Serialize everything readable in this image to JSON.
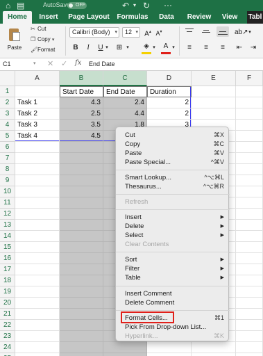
{
  "titlebar": {
    "autosave_label": "AutoSave",
    "autosave_state": "OFF",
    "icons": [
      "home-icon",
      "save-icon",
      "undo-icon",
      "undo-dropdown-icon",
      "redo-icon",
      "more-icon"
    ]
  },
  "tabs": [
    "Home",
    "Insert",
    "Page Layout",
    "Formulas",
    "Data",
    "Review",
    "View",
    "Tabl"
  ],
  "ribbon": {
    "paste_label": "Paste",
    "cut_label": "Cut",
    "copy_label": "Copy",
    "format_label": "Format",
    "font_name": "Calibri (Body)",
    "font_size": "12",
    "bold": "B",
    "italic": "I",
    "underline": "U",
    "fill_color": "#f5d000",
    "font_color": "#e0201a"
  },
  "formula_bar": {
    "name_box": "C1",
    "fx": "fx",
    "content": "End Date"
  },
  "grid": {
    "columns": [
      "A",
      "B",
      "C",
      "D",
      "E",
      "F"
    ],
    "rows": [
      "1",
      "2",
      "3",
      "4",
      "5",
      "6",
      "7",
      "8",
      "9",
      "10",
      "11",
      "12",
      "13",
      "14",
      "15",
      "16",
      "17",
      "18",
      "19",
      "20",
      "21",
      "22",
      "23",
      "24",
      "25"
    ],
    "data": [
      [
        "",
        "Start Date",
        "End Date",
        "Duration"
      ],
      [
        "Task 1",
        "4.3",
        "2.4",
        "2"
      ],
      [
        "Task 2",
        "2.5",
        "4.4",
        "2"
      ],
      [
        "Task 3",
        "3.5",
        "1.8",
        "3"
      ],
      [
        "Task 4",
        "4.5",
        "",
        ""
      ]
    ]
  },
  "context_menu": {
    "items": [
      {
        "label": "Cut",
        "shortcut": "⌘X"
      },
      {
        "label": "Copy",
        "shortcut": "⌘C"
      },
      {
        "label": "Paste",
        "shortcut": "⌘V"
      },
      {
        "label": "Paste Special...",
        "shortcut": "^⌘V"
      },
      {
        "label": "Smart Lookup...",
        "shortcut": "^⌥⌘L"
      },
      {
        "label": "Thesaurus...",
        "shortcut": "^⌥⌘R"
      },
      {
        "label": "Refresh",
        "shortcut": ""
      },
      {
        "label": "Insert",
        "shortcut": ""
      },
      {
        "label": "Delete",
        "shortcut": ""
      },
      {
        "label": "Select",
        "shortcut": ""
      },
      {
        "label": "Clear Contents",
        "shortcut": ""
      },
      {
        "label": "Sort",
        "shortcut": ""
      },
      {
        "label": "Filter",
        "shortcut": ""
      },
      {
        "label": "Table",
        "shortcut": ""
      },
      {
        "label": "Insert Comment",
        "shortcut": ""
      },
      {
        "label": "Delete Comment",
        "shortcut": ""
      },
      {
        "label": "Format Cells...",
        "shortcut": "⌘1"
      },
      {
        "label": "Pick From Drop-down List...",
        "shortcut": ""
      },
      {
        "label": "Hyperlink...",
        "shortcut": "⌘K"
      }
    ]
  },
  "colors": {
    "excel_green": "#1e7145",
    "selection_gray": "#c6c6c6",
    "highlight_red": "#e0201a"
  }
}
